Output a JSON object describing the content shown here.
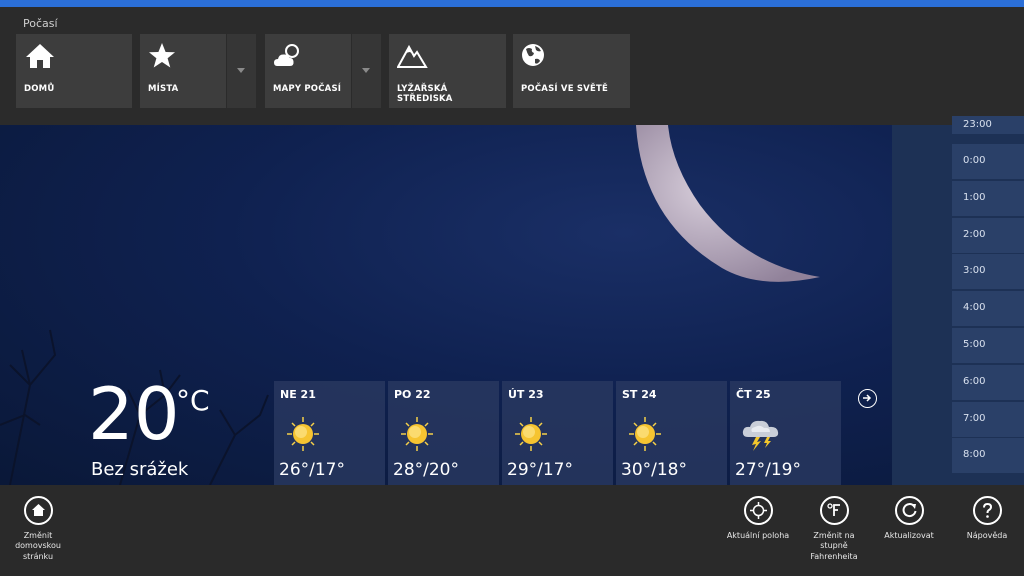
{
  "app_title": "Počasí",
  "nav": [
    {
      "label": "DOMŮ",
      "icon": "home-icon"
    },
    {
      "label": "MÍSTA",
      "icon": "star-icon"
    },
    {
      "label": "MAPY POČASÍ",
      "icon": "weather-map-icon"
    },
    {
      "label": "LYŽAŘSKÁ STŘEDISKA",
      "icon": "mountain-icon"
    },
    {
      "label": "POČASÍ VE SVĚTĚ",
      "icon": "globe-icon"
    }
  ],
  "current": {
    "temp": "20",
    "unit": "°C",
    "condition": "Bez srážek"
  },
  "forecast": [
    {
      "day": "NE 21",
      "temps": "26°/17°",
      "icon": "sun-icon"
    },
    {
      "day": "PO 22",
      "temps": "28°/20°",
      "icon": "sun-icon"
    },
    {
      "day": "ÚT 23",
      "temps": "29°/17°",
      "icon": "sun-icon"
    },
    {
      "day": "ST 24",
      "temps": "30°/18°",
      "icon": "sun-icon"
    },
    {
      "day": "ČT 25",
      "temps": "27°/19°",
      "icon": "thunderstorm-icon"
    }
  ],
  "hourly": [
    "23:00",
    "0:00",
    "1:00",
    "2:00",
    "3:00",
    "4:00",
    "5:00",
    "6:00",
    "7:00",
    "8:00"
  ],
  "appbar": {
    "change_home": "Změnit domovskou stránku",
    "location": "Aktuální poloha",
    "fahrenheit": "Změnit na stupně Fahrenheita",
    "refresh": "Aktualizovat",
    "help": "Nápověda"
  },
  "colors": {
    "accent_stripe": "#2b6fd8",
    "nav_bg": "#2b2b2b",
    "tile_bg": "#3d3d3d",
    "sky": "#0f2150"
  }
}
